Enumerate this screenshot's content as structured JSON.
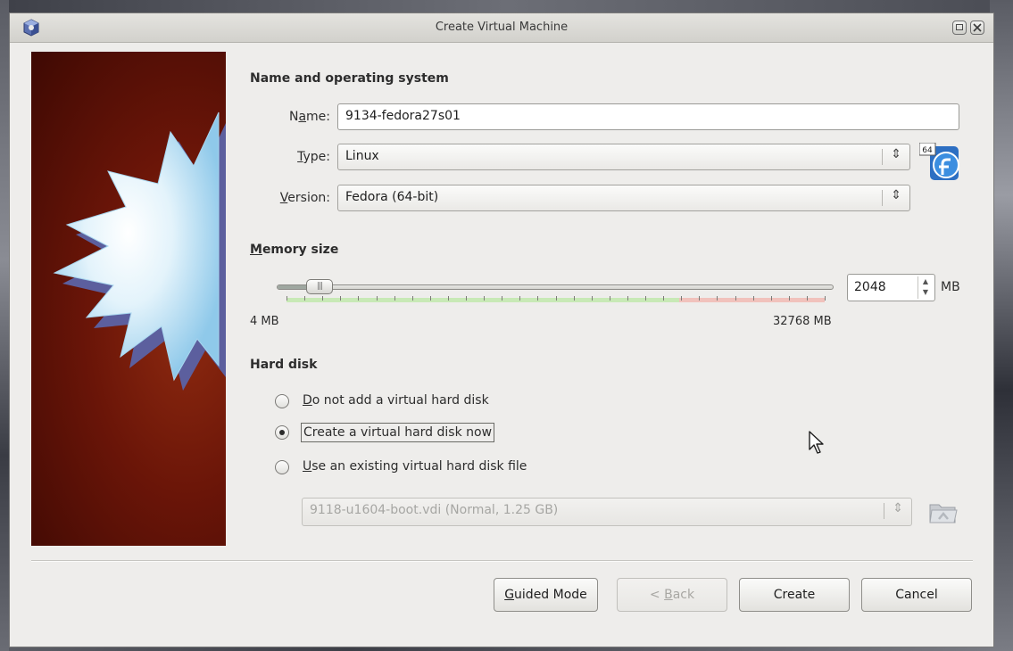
{
  "window": {
    "title": "Create Virtual Machine"
  },
  "sections": {
    "name_os": "Name and operating system",
    "memory": "Memory size",
    "hard_disk": "Hard disk"
  },
  "name_field": {
    "label_pre": "N",
    "label_u": "a",
    "label_post": "me:",
    "value": "9134-fedora27s01"
  },
  "type_field": {
    "label_pre": "",
    "label_u": "T",
    "label_post": "ype:",
    "value": "Linux"
  },
  "version_field": {
    "label_pre": "",
    "label_u": "V",
    "label_post": "ersion:",
    "value": "Fedora (64-bit)"
  },
  "os_icon": {
    "name": "fedora-64bit-icon",
    "badge": "64"
  },
  "memory": {
    "value": "2048",
    "unit": "MB",
    "min_label": "4 MB",
    "max_label": "32768 MB",
    "slider_fraction": 0.0625
  },
  "hard_disk": {
    "options": [
      {
        "pre": "",
        "u": "D",
        "post": "o not add a virtual hard disk",
        "checked": false
      },
      {
        "pre": "",
        "u": "",
        "post": "Create a virtual hard disk now",
        "checked": true
      },
      {
        "pre": "",
        "u": "U",
        "post": "se an existing virtual hard disk file",
        "checked": false
      }
    ],
    "existing_file": "9118-u1604-boot.vdi (Normal, 1.25 GB)"
  },
  "buttons": {
    "guided_pre": "",
    "guided_u": "G",
    "guided_post": "uided Mode",
    "back_pre": "< ",
    "back_u": "B",
    "back_post": "ack",
    "create": "Create",
    "cancel": "Cancel"
  },
  "colors": {
    "window_bg": "#eeedeb",
    "banner_red": "#6a1508",
    "scale_green": "#c8e9b6",
    "scale_red": "#f1c2bc"
  }
}
